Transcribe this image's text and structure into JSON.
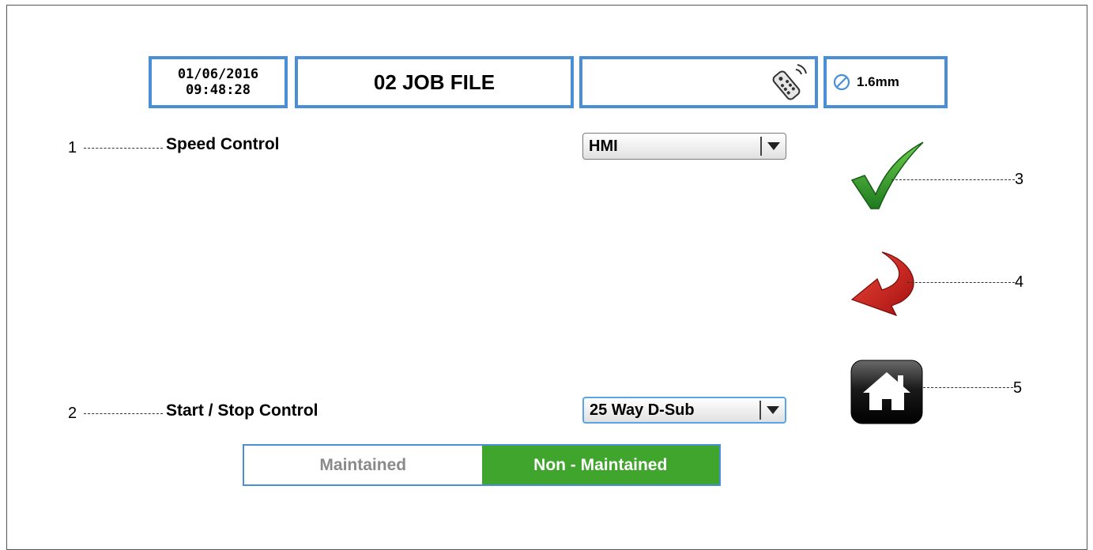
{
  "header": {
    "date": "01/06/2016",
    "time": "09:48:28",
    "job_title": "02 JOB FILE",
    "remote_icon": "remote-control-icon",
    "thickness": "1.6mm",
    "thickness_icon": "diameter-icon"
  },
  "callouts": [
    "1",
    "2",
    "3",
    "4",
    "5"
  ],
  "speed_control": {
    "label": "Speed Control",
    "value": "HMI"
  },
  "start_stop_control": {
    "label": "Start / Stop Control",
    "value": "25 Way D-Sub"
  },
  "mode_toggle": {
    "options": [
      "Maintained",
      "Non - Maintained"
    ],
    "selected": "Non - Maintained"
  },
  "actions": {
    "confirm_icon": "checkmark-icon",
    "back_icon": "back-arrow-icon",
    "home_icon": "home-icon"
  },
  "colors": {
    "border_blue": "#4a8fd6",
    "active_green": "#3fa52c",
    "check_green": "#2e8b2e",
    "arrow_red": "#cc1a1a"
  }
}
